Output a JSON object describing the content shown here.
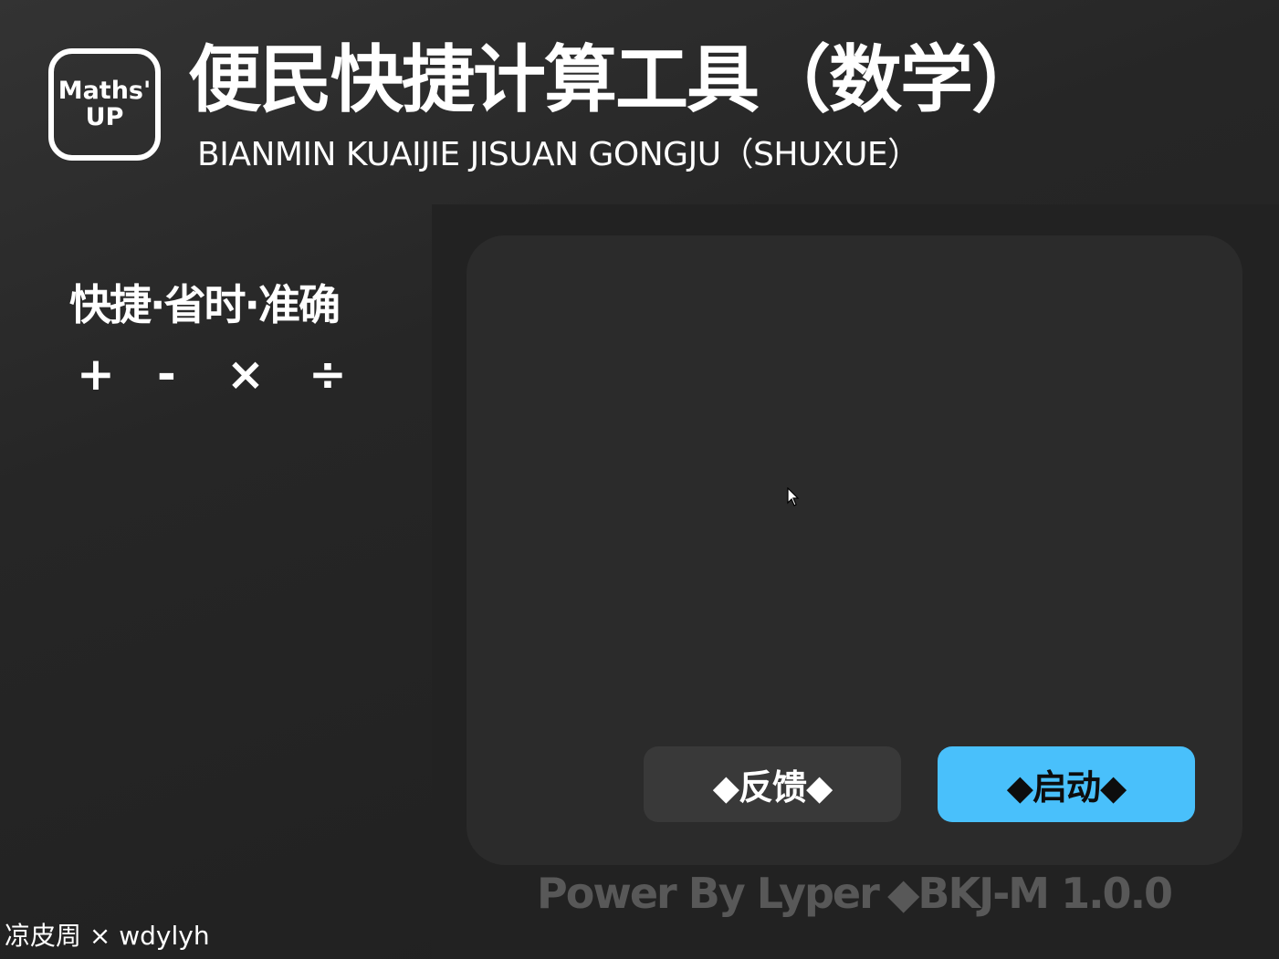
{
  "header": {
    "logo_line1": "Maths'",
    "logo_line2": "UP",
    "title": "便民快捷计算工具（数学）",
    "subtitle": "BIANMIN KUAIJIE JISUAN GONGJU（SHUXUE）"
  },
  "sidebar": {
    "slogan": "快捷·省时·准确",
    "operators": [
      "+",
      "-",
      "×",
      "÷"
    ]
  },
  "actions": {
    "feedback_label": "◆反馈◆",
    "start_label": "◆启动◆"
  },
  "footer": {
    "power": "Power By Lyper",
    "version": "◆BKJ-M 1.0.0",
    "credit": "凉皮周 × wdylyh"
  },
  "colors": {
    "accent": "#49c0fb",
    "background": "#232323",
    "panel": "#2b2b2b",
    "secondary_button": "#393939"
  },
  "icons": {
    "cursor": "mouse-pointer-icon"
  }
}
